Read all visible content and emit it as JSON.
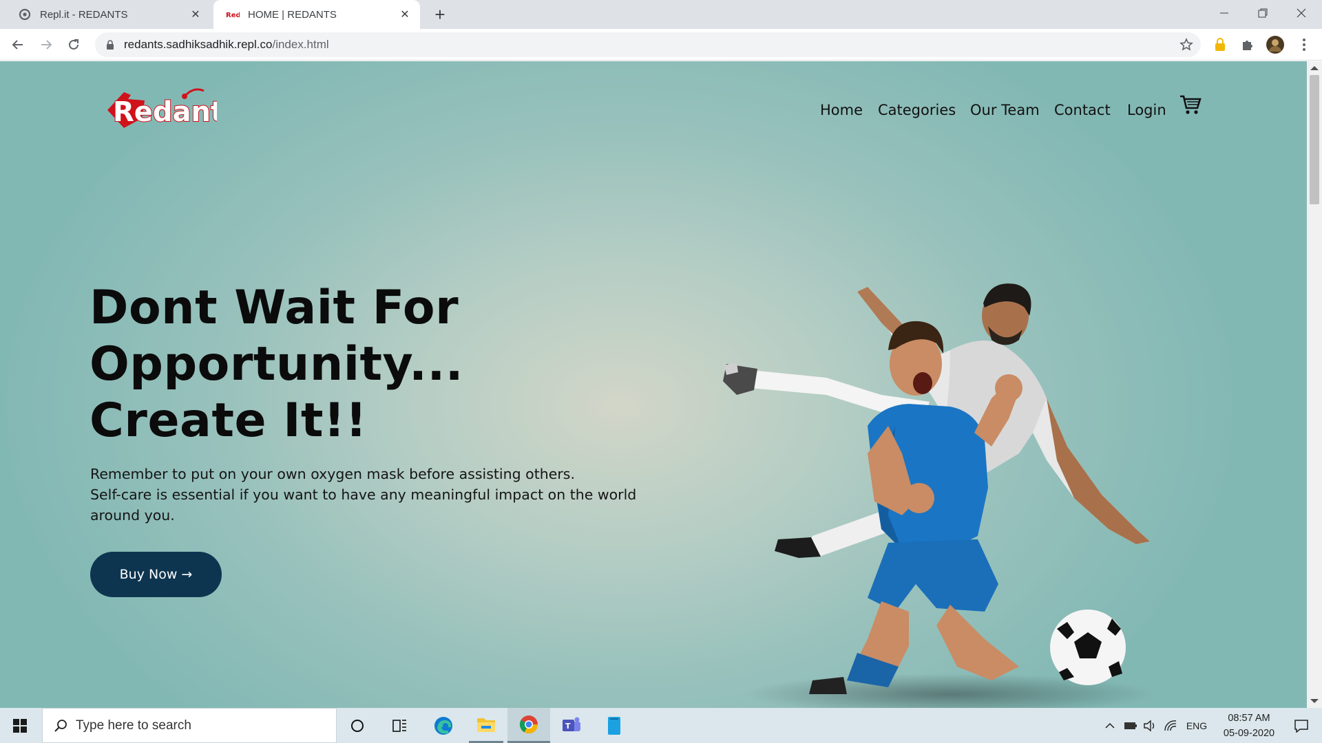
{
  "browser": {
    "tabs": [
      {
        "title": "Repl.it - REDANTS",
        "favicon": "replit-icon",
        "active": false
      },
      {
        "title": "HOME | REDANTS",
        "favicon": "redant-favicon",
        "active": true
      }
    ],
    "url_host": "redants.sadhiksadhik.repl.co",
    "url_path": "/index.html"
  },
  "site": {
    "logo_text": "Redant",
    "nav": [
      "Home",
      "Categories",
      "Our Team",
      "Contact",
      "Login"
    ],
    "headline": [
      "Dont Wait For",
      "Opportunity...",
      "Create It!!"
    ],
    "subtext": [
      "Remember to put on your own oxygen mask before assisting others.",
      "Self-care is essential if you want to have any meaningful impact on the world",
      "around you."
    ],
    "cta_label": "Buy Now →"
  },
  "taskbar": {
    "search_placeholder": "Type here to search",
    "language": "ENG",
    "time": "08:57 AM",
    "date": "05-09-2020",
    "pinned": [
      "task-view",
      "edge",
      "file-explorer",
      "chrome",
      "teams",
      "notes"
    ]
  },
  "colors": {
    "cta_bg": "#0d3550",
    "brand_red": "#d0121b",
    "page_bg": "#98c1bc"
  }
}
